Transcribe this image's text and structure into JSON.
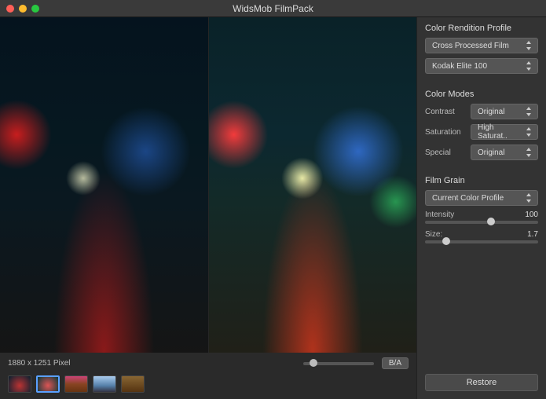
{
  "window": {
    "title": "WidsMob FilmPack"
  },
  "preview": {
    "dimensions": "1880 x 1251 Pixel",
    "ba_label": "B/A"
  },
  "thumbnails": [
    {
      "id": "thumb-1"
    },
    {
      "id": "thumb-2",
      "selected": true
    },
    {
      "id": "thumb-3"
    },
    {
      "id": "thumb-4"
    },
    {
      "id": "thumb-5"
    }
  ],
  "panel": {
    "profile": {
      "title": "Color Rendition Profile",
      "film_type": "Cross Processed Film",
      "film_stock": "Kodak Elite 100"
    },
    "color_modes": {
      "title": "Color Modes",
      "contrast_label": "Contrast",
      "contrast_value": "Original",
      "saturation_label": "Saturation",
      "saturation_value": "High Saturat..",
      "special_label": "Special",
      "special_value": "Original"
    },
    "film_grain": {
      "title": "Film Grain",
      "profile": "Current Color Profile",
      "intensity_label": "Intensity",
      "intensity_value": "100",
      "intensity_pct": 55,
      "size_label": "Size:",
      "size_value": "1.7",
      "size_pct": 15
    },
    "restore_label": "Restore"
  }
}
